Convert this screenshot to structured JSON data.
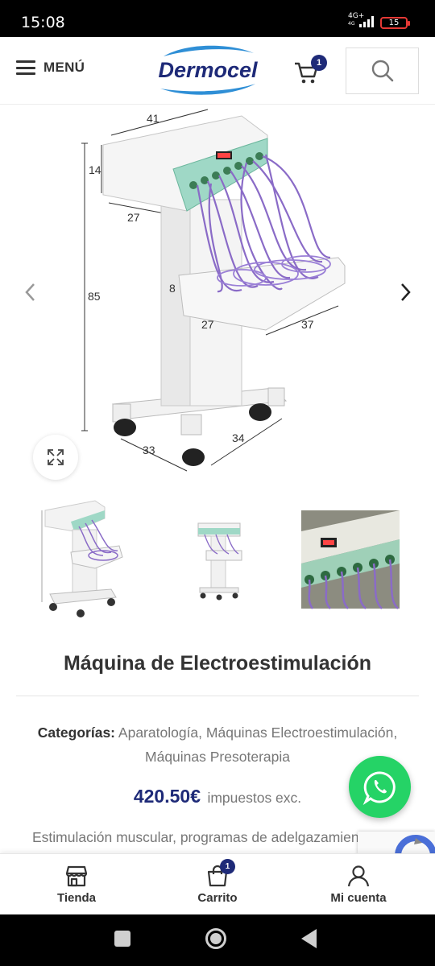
{
  "status_bar": {
    "time": "15:08",
    "network": "4G+",
    "network_sub": "4G",
    "battery": "15"
  },
  "header": {
    "menu_label": "MENÚ",
    "logo_text": "Dermocel",
    "cart_count": "1",
    "search_icon": "search-icon"
  },
  "gallery": {
    "dimensions": {
      "top_width": "41",
      "head_height": "14",
      "head_depth": "27",
      "total_height": "85",
      "tray_height": "8",
      "tray_depth": "27",
      "tray_width": "37",
      "base_depth": "33",
      "base_width": "34"
    },
    "thumbnails": 3
  },
  "product": {
    "title": "Máquina de Electroestimulación",
    "categories_label": "Categorías:",
    "categories": [
      "Aparatología",
      "Máquinas Electroestimulación",
      "Máquinas Presoterapia"
    ],
    "price": "420.50€",
    "tax_note": "impuestos exc.",
    "description": "Estimulación muscular, programas de adelgazamiento"
  },
  "bottom_nav": {
    "items": [
      {
        "label": "Tienda",
        "icon": "store-icon"
      },
      {
        "label": "Carrito",
        "icon": "cart-icon",
        "badge": "1"
      },
      {
        "label": "Mi cuenta",
        "icon": "user-icon"
      }
    ]
  },
  "colors": {
    "brand": "#1e2a78",
    "whatsapp": "#25d366",
    "text": "#333333",
    "muted": "#777777"
  }
}
